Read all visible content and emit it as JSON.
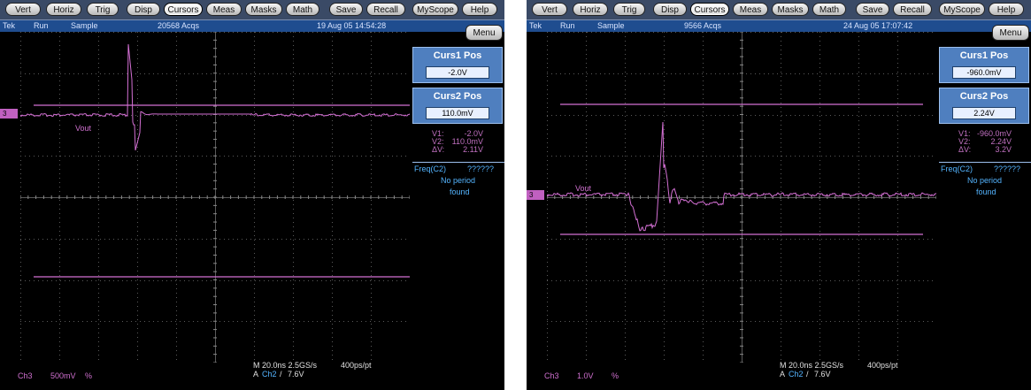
{
  "menubar": [
    {
      "label": "Vert",
      "active": false
    },
    {
      "label": "Horiz",
      "active": false
    },
    {
      "label": "Trig",
      "active": false
    },
    {
      "label": "Disp",
      "active": false
    },
    {
      "label": "Cursors",
      "active": true
    },
    {
      "label": "Meas",
      "active": false
    },
    {
      "label": "Masks",
      "active": false
    },
    {
      "label": "Math",
      "active": false
    },
    {
      "label": "Save",
      "active": false
    },
    {
      "label": "Recall",
      "active": false
    },
    {
      "label": "MyScope",
      "active": false
    },
    {
      "label": "Help",
      "active": false
    }
  ],
  "screens": [
    {
      "status": {
        "brand": "Tek",
        "run": "Run",
        "mode": "Sample",
        "acqs": "20568 Acqs",
        "datetime": "19 Aug 05 14:54:28"
      },
      "menu_label": "Menu",
      "curs1": {
        "title": "Curs1 Pos",
        "value": "-2.0V"
      },
      "curs2": {
        "title": "Curs2 Pos",
        "value": "110.0mV"
      },
      "readout": [
        {
          "k": "V1:",
          "v": "-2.0V"
        },
        {
          "k": "V2:",
          "v": "110.0mV"
        },
        {
          "k": "ΔV:",
          "v": "2.11V"
        }
      ],
      "freq": {
        "label": "Freq(C2)",
        "value": "??????",
        "msg1": "No period",
        "msg2": "found"
      },
      "channel_marker": "3",
      "vout_label": "Vout",
      "bottom": {
        "channel": "Ch3",
        "scale": "500mV",
        "coupling": "%",
        "timebase": "M 20.0ns 2.5GS/s",
        "trig_prefix": "A",
        "trig_ch": "Ch2",
        "trig_slope": "/",
        "trig_level": "7.6V",
        "rate": "400ps/pt"
      },
      "colors": {
        "trace": "#d470d4",
        "grid": "#5a5a5a",
        "panel": "#4f7fbf"
      }
    },
    {
      "status": {
        "brand": "Tek",
        "run": "Run",
        "mode": "Sample",
        "acqs": "9566 Acqs",
        "datetime": "24 Aug 05 17:07:42"
      },
      "menu_label": "Menu",
      "curs1": {
        "title": "Curs1 Pos",
        "value": "-960.0mV"
      },
      "curs2": {
        "title": "Curs2 Pos",
        "value": "2.24V"
      },
      "readout": [
        {
          "k": "V1:",
          "v": "-960.0mV"
        },
        {
          "k": "V2:",
          "v": "2.24V"
        },
        {
          "k": "ΔV:",
          "v": "3.2V"
        }
      ],
      "freq": {
        "label": "Freq(C2)",
        "value": "??????",
        "msg1": "No period",
        "msg2": "found"
      },
      "channel_marker": "3",
      "vout_label": "Vout",
      "bottom": {
        "channel": "Ch3",
        "scale": "1.0V",
        "coupling": "%",
        "timebase": "M 20.0ns 2.5GS/s",
        "trig_prefix": "A",
        "trig_ch": "Ch2",
        "trig_slope": "/",
        "trig_level": "7.6V",
        "rate": "400ps/pt"
      },
      "colors": {
        "trace": "#d470d4",
        "grid": "#5a5a5a",
        "panel": "#4f7fbf"
      }
    }
  ]
}
